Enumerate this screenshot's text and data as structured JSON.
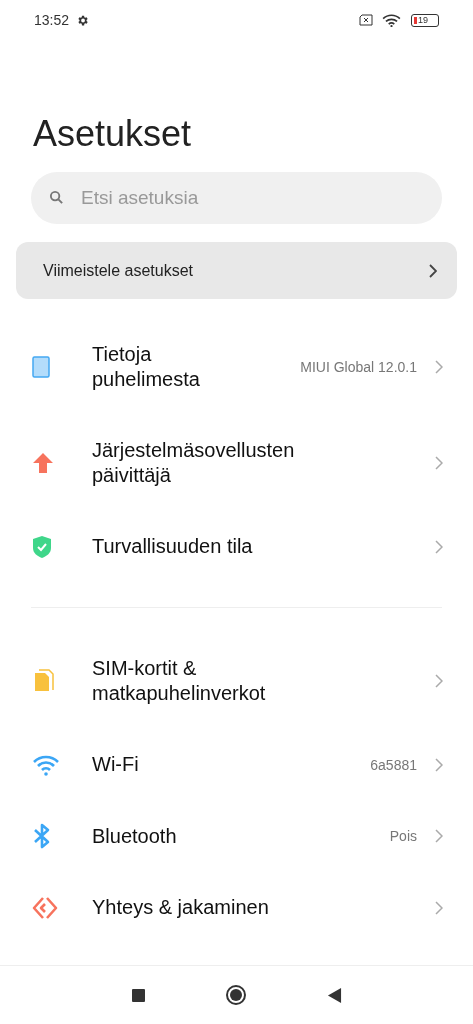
{
  "status_bar": {
    "time": "13:52",
    "battery": "19"
  },
  "title": "Asetukset",
  "search": {
    "placeholder": "Etsi asetuksia"
  },
  "banner": {
    "label": "Viimeistele asetukset"
  },
  "groups": [
    {
      "items": [
        {
          "kind": "tablet",
          "label": "Tietoja puhelimesta",
          "value": "MIUI Global 12.0.1"
        },
        {
          "kind": "update",
          "label": "Järjestelmäsovellusten päivittäjä"
        },
        {
          "kind": "shield",
          "label": "Turvallisuuden tila"
        }
      ]
    },
    {
      "items": [
        {
          "kind": "sim",
          "label": "SIM-kortit & matkapuhelinverkot"
        },
        {
          "kind": "wifi",
          "label": "Wi-Fi",
          "value": "6a5881"
        },
        {
          "kind": "bluetooth",
          "label": "Bluetooth",
          "value": "Pois"
        },
        {
          "kind": "share",
          "label": "Yhteys & jakaminen"
        }
      ]
    }
  ]
}
